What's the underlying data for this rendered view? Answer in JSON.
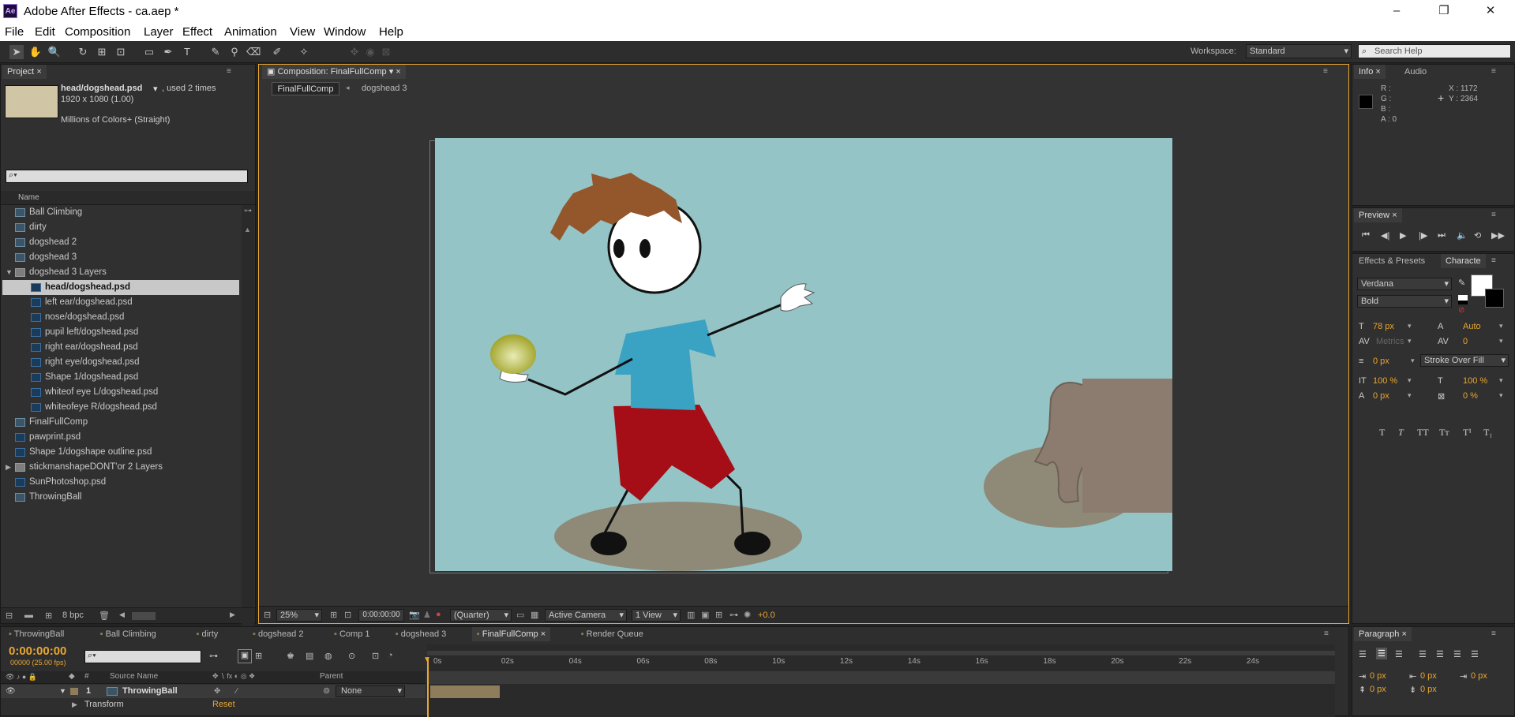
{
  "app": {
    "title": "Adobe After Effects - ca.aep *",
    "logo": "Ae"
  },
  "window_controls": {
    "minimize": "–",
    "maximize": "❐",
    "close": "✕"
  },
  "menu": [
    "File",
    "Edit",
    "Composition",
    "Layer",
    "Effect",
    "Animation",
    "View",
    "Window",
    "Help"
  ],
  "toolbar": {
    "workspace_label": "Workspace:",
    "workspace_value": "Standard",
    "search_placeholder": "Search Help"
  },
  "project": {
    "tab": "Project",
    "item_name": "head/dogshead.psd",
    "item_used": ", used 2 times",
    "item_dims": "1920 x 1080 (1.00)",
    "item_color": "Millions of Colors+ (Straight)",
    "col_name": "Name",
    "bpc": "8 bpc",
    "items": [
      {
        "label": "Ball Climbing",
        "type": "comp",
        "indent": 0
      },
      {
        "label": "dirty",
        "type": "comp",
        "indent": 0
      },
      {
        "label": "dogshead 2",
        "type": "comp",
        "indent": 0
      },
      {
        "label": "dogshead 3",
        "type": "comp",
        "indent": 0
      },
      {
        "label": "dogshead 3 Layers",
        "type": "folder",
        "indent": 0
      },
      {
        "label": "head/dogshead.psd",
        "type": "psd",
        "indent": 1,
        "selected": true
      },
      {
        "label": "left ear/dogshead.psd",
        "type": "psd",
        "indent": 1
      },
      {
        "label": "nose/dogshead.psd",
        "type": "psd",
        "indent": 1
      },
      {
        "label": "pupil left/dogshead.psd",
        "type": "psd",
        "indent": 1
      },
      {
        "label": "right ear/dogshead.psd",
        "type": "psd",
        "indent": 1
      },
      {
        "label": "right eye/dogshead.psd",
        "type": "psd",
        "indent": 1
      },
      {
        "label": "Shape 1/dogshead.psd",
        "type": "psd",
        "indent": 1
      },
      {
        "label": "whiteof eye L/dogshead.psd",
        "type": "psd",
        "indent": 1
      },
      {
        "label": "whiteofeye R/dogshead.psd",
        "type": "psd",
        "indent": 1
      },
      {
        "label": "FinalFullComp",
        "type": "comp",
        "indent": 0
      },
      {
        "label": "pawprint.psd",
        "type": "psd",
        "indent": 0
      },
      {
        "label": "Shape 1/dogshape outline.psd",
        "type": "psd",
        "indent": 0
      },
      {
        "label": "stickmanshapeDONT'or 2 Layers",
        "type": "folder",
        "indent": 0
      },
      {
        "label": "SunPhotoshop.psd",
        "type": "psd",
        "indent": 0
      },
      {
        "label": "ThrowingBall",
        "type": "comp",
        "indent": 0
      }
    ]
  },
  "composition": {
    "tab": "Composition: FinalFullComp",
    "breadcrumb_active": "FinalFullComp",
    "breadcrumb_next": "dogshead 3",
    "zoom": "25%",
    "timecode": "0:00:00:00",
    "resolution": "(Quarter)",
    "camera": "Active Camera",
    "views": "1 View",
    "exposure": "+0.0"
  },
  "info": {
    "tab_info": "Info",
    "tab_audio": "Audio",
    "r": "R :",
    "g": "G :",
    "b": "B :",
    "a": "A : 0",
    "x": "X : 1172",
    "y": "Y : 2364"
  },
  "preview": {
    "tab": "Preview"
  },
  "effects": {
    "tab_effects": "Effects & Presets",
    "tab_character": "Characte"
  },
  "character": {
    "font": "Verdana",
    "style": "Bold",
    "size": "78 px",
    "leading": "Auto",
    "kerning": "Metrics",
    "tracking": "0",
    "stroke_width": "0 px",
    "stroke_type": "Stroke Over Fill",
    "vscale": "100 %",
    "hscale": "100 %",
    "baseline": "0 px",
    "tsume": "0 %",
    "styles": [
      "T",
      "T",
      "TT",
      "Tт",
      "T¹",
      "T₁"
    ]
  },
  "paragraph": {
    "tab": "Paragraph",
    "indent_values": [
      "0 px",
      "0 px",
      "0 px",
      "0 px",
      "0 px"
    ]
  },
  "timeline": {
    "tabs": [
      {
        "label": "ThrowingBall",
        "active": false
      },
      {
        "label": "Ball Climbing",
        "active": false
      },
      {
        "label": "dirty",
        "active": false
      },
      {
        "label": "dogshead 2",
        "active": false
      },
      {
        "label": "Comp 1",
        "active": false
      },
      {
        "label": "dogshead 3",
        "active": false
      },
      {
        "label": "FinalFullComp",
        "active": true
      },
      {
        "label": "Render Queue",
        "active": false
      }
    ],
    "timecode": "0:00:00:00",
    "frames": "00000 (25.00 fps)",
    "col_source": "Source Name",
    "col_parent": "Parent",
    "col_num": "#",
    "layer_num": "1",
    "layer_name": "ThrowingBall",
    "parent_value": "None",
    "transform": "Transform",
    "reset": "Reset",
    "ruler": [
      "0s",
      "02s",
      "04s",
      "06s",
      "08s",
      "10s",
      "12s",
      "14s",
      "16s",
      "18s",
      "20s",
      "22s",
      "24s"
    ]
  },
  "colors": {
    "accent": "#e8a631",
    "canvas_bg": "#94c4c6",
    "shirt": "#3aa3c3",
    "shorts": "#a50e16",
    "hair": "#94562b",
    "shadow": "#8f8a78",
    "dog": "#8c7c70"
  }
}
